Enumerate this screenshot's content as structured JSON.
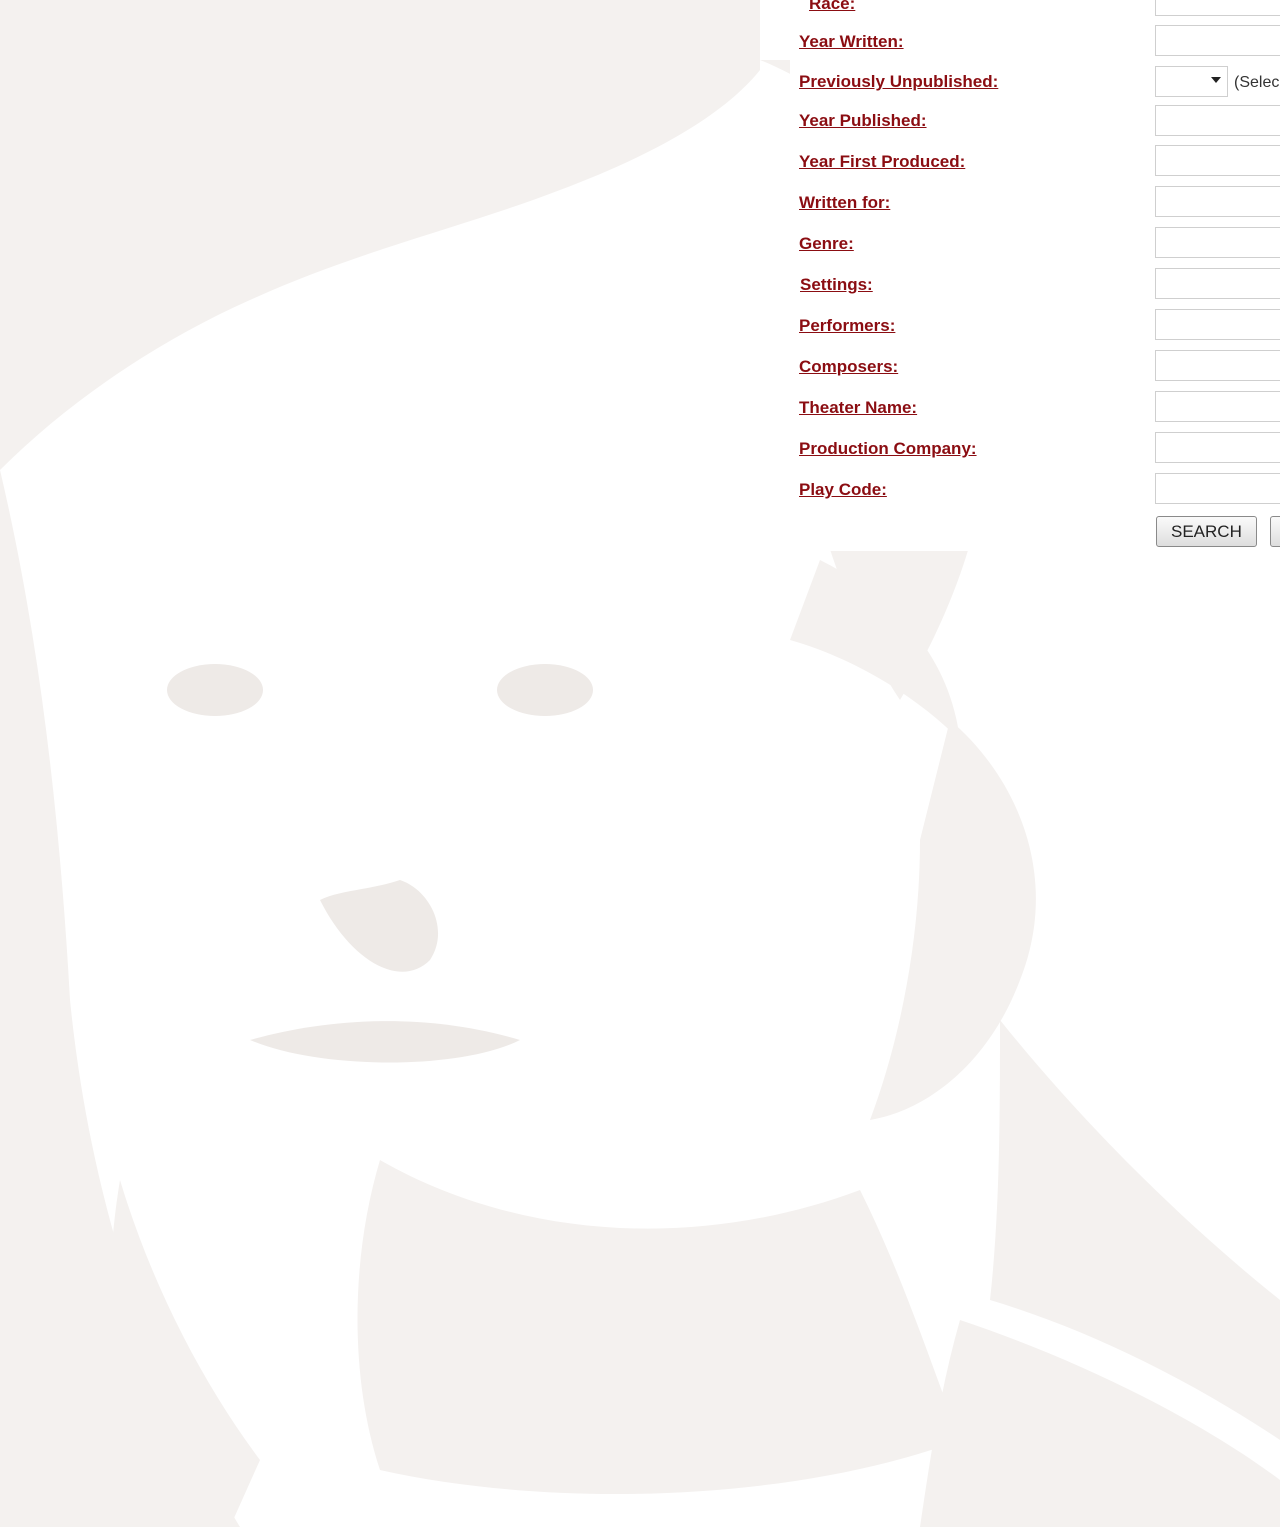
{
  "form": {
    "fields": [
      {
        "label": "Race:"
      },
      {
        "label": "Year Written:"
      },
      {
        "label": "Previously Unpublished:"
      },
      {
        "label": "Year Published:"
      },
      {
        "label": "Year First Produced:"
      },
      {
        "label": "Written for:"
      },
      {
        "label": "Genre:"
      },
      {
        "label": "Settings:"
      },
      {
        "label": "Performers:"
      },
      {
        "label": "Composers:"
      },
      {
        "label": "Theater Name:"
      },
      {
        "label": "Production Company:"
      },
      {
        "label": "Play Code:"
      }
    ],
    "previously_unpublished_value": "",
    "previously_unpublished_hint": "(Selec",
    "search_button": "SEARCH",
    "second_button": ""
  },
  "colors": {
    "label": "#8b0d12",
    "background": "#ffffff",
    "watermark": "#f4f1ef"
  },
  "icons": {
    "select_arrow": "chevron-down-icon"
  }
}
